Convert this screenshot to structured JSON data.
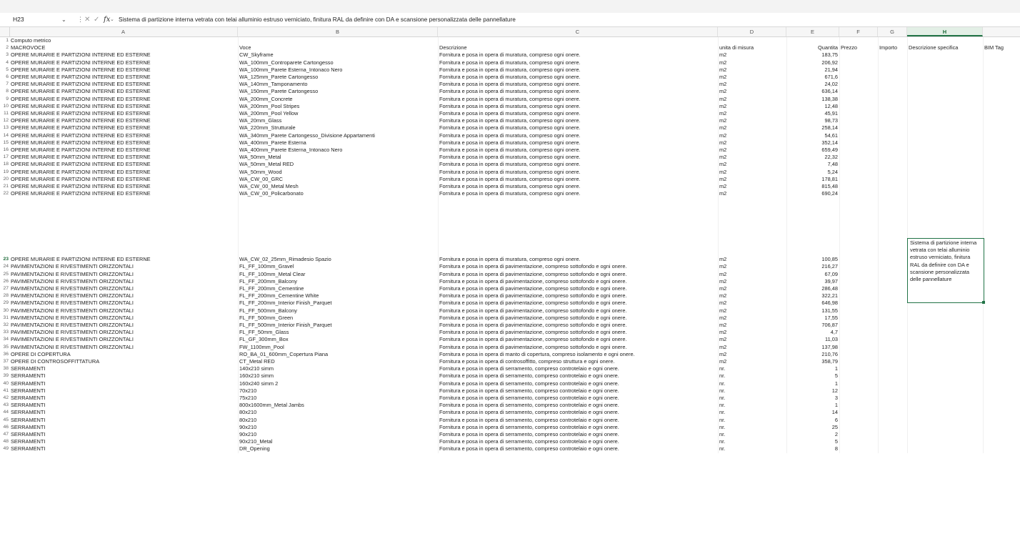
{
  "formula_bar": {
    "name_box": "H23",
    "formula": "Sistema di partizione interna vetrata con telai alluminio estruso verniciato, finitura RAL da definire con DA e scansione personalizzata delle pannellature"
  },
  "columns": [
    "A",
    "B",
    "C",
    "D",
    "E",
    "F",
    "G",
    "H"
  ],
  "selected_column": "H",
  "selected_row": "23",
  "rows": [
    {
      "n": "1",
      "a": "Computo metrico",
      "b": "",
      "c": "",
      "d": "",
      "e": "",
      "f": "",
      "g": "",
      "h": "",
      "i": ""
    },
    {
      "n": "2",
      "a": "MACROVOCE",
      "b": "Voce",
      "c": "Descrizione",
      "d": "unita di misura",
      "e": "Quantita",
      "f": "Prezzo",
      "g": "Importo",
      "h": "Descrizione specifica",
      "i": "BIM Tag"
    },
    {
      "n": "3",
      "a": "OPERE MURARIE E PARTIZIONI INTERNE ED ESTERNE",
      "b": "CW_Skyframe",
      "c": "Fornitura e posa in opera di muratura, compreso ogni onere.",
      "d": "m2",
      "e": "183,75"
    },
    {
      "n": "4",
      "a": "OPERE MURARIE E PARTIZIONI INTERNE ED ESTERNE",
      "b": "WA_100mm_Controparete Cartongesso",
      "c": "Fornitura e posa in opera di muratura, compreso ogni onere.",
      "d": "m2",
      "e": "206,92"
    },
    {
      "n": "5",
      "a": "OPERE MURARIE E PARTIZIONI INTERNE ED ESTERNE",
      "b": "WA_100mm_Parete Esterna_Intonaco Nero",
      "c": "Fornitura e posa in opera di muratura, compreso ogni onere.",
      "d": "m2",
      "e": "21,94"
    },
    {
      "n": "6",
      "a": "OPERE MURARIE E PARTIZIONI INTERNE ED ESTERNE",
      "b": "WA_125mm_Parete Cartongesso",
      "c": "Fornitura e posa in opera di muratura, compreso ogni onere.",
      "d": "m2",
      "e": "671,6"
    },
    {
      "n": "7",
      "a": "OPERE MURARIE E PARTIZIONI INTERNE ED ESTERNE",
      "b": "WA_140mm_Tamponamento",
      "c": "Fornitura e posa in opera di muratura, compreso ogni onere.",
      "d": "m2",
      "e": "24,02"
    },
    {
      "n": "8",
      "a": "OPERE MURARIE E PARTIZIONI INTERNE ED ESTERNE",
      "b": "WA_150mm_Parete Cartongesso",
      "c": "Fornitura e posa in opera di muratura, compreso ogni onere.",
      "d": "m2",
      "e": "636,14"
    },
    {
      "n": "9",
      "a": "OPERE MURARIE E PARTIZIONI INTERNE ED ESTERNE",
      "b": "WA_200mm_Concrete",
      "c": "Fornitura e posa in opera di muratura, compreso ogni onere.",
      "d": "m2",
      "e": "138,38"
    },
    {
      "n": "10",
      "a": "OPERE MURARIE E PARTIZIONI INTERNE ED ESTERNE",
      "b": "WA_200mm_Pool Stripes",
      "c": "Fornitura e posa in opera di muratura, compreso ogni onere.",
      "d": "m2",
      "e": "12,48"
    },
    {
      "n": "11",
      "a": "OPERE MURARIE E PARTIZIONI INTERNE ED ESTERNE",
      "b": "WA_200mm_Pool Yellow",
      "c": "Fornitura e posa in opera di muratura, compreso ogni onere.",
      "d": "m2",
      "e": "45,91"
    },
    {
      "n": "12",
      "a": "OPERE MURARIE E PARTIZIONI INTERNE ED ESTERNE",
      "b": "WA_20mm_Glass",
      "c": "Fornitura e posa in opera di muratura, compreso ogni onere.",
      "d": "m2",
      "e": "98,73"
    },
    {
      "n": "13",
      "a": "OPERE MURARIE E PARTIZIONI INTERNE ED ESTERNE",
      "b": "WA_220mm_Strutturale",
      "c": "Fornitura e posa in opera di muratura, compreso ogni onere.",
      "d": "m2",
      "e": "258,14"
    },
    {
      "n": "14",
      "a": "OPERE MURARIE E PARTIZIONI INTERNE ED ESTERNE",
      "b": "WA_340mm_Parete Cartongesso_Divisione Appartamenti",
      "c": "Fornitura e posa in opera di muratura, compreso ogni onere.",
      "d": "m2",
      "e": "54,61"
    },
    {
      "n": "15",
      "a": "OPERE MURARIE E PARTIZIONI INTERNE ED ESTERNE",
      "b": "WA_400mm_Parete Esterna",
      "c": "Fornitura e posa in opera di muratura, compreso ogni onere.",
      "d": "m2",
      "e": "352,14"
    },
    {
      "n": "16",
      "a": "OPERE MURARIE E PARTIZIONI INTERNE ED ESTERNE",
      "b": "WA_400mm_Parete Esterna_Intonaco Nero",
      "c": "Fornitura e posa in opera di muratura, compreso ogni onere.",
      "d": "m2",
      "e": "659,49"
    },
    {
      "n": "17",
      "a": "OPERE MURARIE E PARTIZIONI INTERNE ED ESTERNE",
      "b": "WA_50mm_Metal",
      "c": "Fornitura e posa in opera di muratura, compreso ogni onere.",
      "d": "m2",
      "e": "22,32"
    },
    {
      "n": "18",
      "a": "OPERE MURARIE E PARTIZIONI INTERNE ED ESTERNE",
      "b": "WA_50mm_Metal RED",
      "c": "Fornitura e posa in opera di muratura, compreso ogni onere.",
      "d": "m2",
      "e": "7,48"
    },
    {
      "n": "19",
      "a": "OPERE MURARIE E PARTIZIONI INTERNE ED ESTERNE",
      "b": "WA_50mm_Wood",
      "c": "Fornitura e posa in opera di muratura, compreso ogni onere.",
      "d": "m2",
      "e": "5,24"
    },
    {
      "n": "20",
      "a": "OPERE MURARIE E PARTIZIONI INTERNE ED ESTERNE",
      "b": "WA_CW_00_GRC",
      "c": "Fornitura e posa in opera di muratura, compreso ogni onere.",
      "d": "m2",
      "e": "178,81"
    },
    {
      "n": "21",
      "a": "OPERE MURARIE E PARTIZIONI INTERNE ED ESTERNE",
      "b": "WA_CW_00_Metal Mesh",
      "c": "Fornitura e posa in opera di muratura, compreso ogni onere.",
      "d": "m2",
      "e": "815,48"
    },
    {
      "n": "22",
      "a": "OPERE MURARIE E PARTIZIONI INTERNE ED ESTERNE",
      "b": "WA_CW_00_Policarbonato",
      "c": "Fornitura e posa in opera di muratura, compreso ogni onere.",
      "d": "m2",
      "e": "690,24"
    },
    {
      "n": "23",
      "a": "OPERE MURARIE E PARTIZIONI INTERNE ED ESTERNE",
      "b": "WA_CW_02_25mm_Rimadesio Spazio",
      "c": "Fornitura e posa in opera di muratura, compreso ogni onere.",
      "d": "m2",
      "e": "100,85",
      "h": "Sistema di partizione interna vetrata con telai alluminio estruso verniciato, finitura RAL da definire con DA e scansione personalizzata delle pannellature"
    },
    {
      "n": "24",
      "a": "PAVIMENTAZIONI E RIVESTIMENTI ORIZZONTALI",
      "b": "FL_FF_100mm_Gravel",
      "c": "Fornitura e posa in opera di pavimentazione, compreso sottofondo e ogni onere.",
      "d": "m2",
      "e": "216,27"
    },
    {
      "n": "25",
      "a": "PAVIMENTAZIONI E RIVESTIMENTI ORIZZONTALI",
      "b": "FL_FF_100mm_Metal Clear",
      "c": "Fornitura e posa in opera di pavimentazione, compreso sottofondo e ogni onere.",
      "d": "m2",
      "e": "67,09"
    },
    {
      "n": "26",
      "a": "PAVIMENTAZIONI E RIVESTIMENTI ORIZZONTALI",
      "b": "FL_FF_200mm_Balcony",
      "c": "Fornitura e posa in opera di pavimentazione, compreso sottofondo e ogni onere.",
      "d": "m2",
      "e": "39,97"
    },
    {
      "n": "27",
      "a": "PAVIMENTAZIONI E RIVESTIMENTI ORIZZONTALI",
      "b": "FL_FF_200mm_Cementine",
      "c": "Fornitura e posa in opera di pavimentazione, compreso sottofondo e ogni onere.",
      "d": "m2",
      "e": "286,48"
    },
    {
      "n": "28",
      "a": "PAVIMENTAZIONI E RIVESTIMENTI ORIZZONTALI",
      "b": "FL_FF_200mm_Cementine White",
      "c": "Fornitura e posa in opera di pavimentazione, compreso sottofondo e ogni onere.",
      "d": "m2",
      "e": "322,21"
    },
    {
      "n": "29",
      "a": "PAVIMENTAZIONI E RIVESTIMENTI ORIZZONTALI",
      "b": "FL_FF_200mm_Interior Finish_Parquet",
      "c": "Fornitura e posa in opera di pavimentazione, compreso sottofondo e ogni onere.",
      "d": "m2",
      "e": "646,98"
    },
    {
      "n": "30",
      "a": "PAVIMENTAZIONI E RIVESTIMENTI ORIZZONTALI",
      "b": "FL_FF_500mm_Balcony",
      "c": "Fornitura e posa in opera di pavimentazione, compreso sottofondo e ogni onere.",
      "d": "m2",
      "e": "131,55"
    },
    {
      "n": "31",
      "a": "PAVIMENTAZIONI E RIVESTIMENTI ORIZZONTALI",
      "b": "FL_FF_500mm_Green",
      "c": "Fornitura e posa in opera di pavimentazione, compreso sottofondo e ogni onere.",
      "d": "m2",
      "e": "17,55"
    },
    {
      "n": "32",
      "a": "PAVIMENTAZIONI E RIVESTIMENTI ORIZZONTALI",
      "b": "FL_FF_500mm_Interior Finish_Parquet",
      "c": "Fornitura e posa in opera di pavimentazione, compreso sottofondo e ogni onere.",
      "d": "m2",
      "e": "706,87"
    },
    {
      "n": "33",
      "a": "PAVIMENTAZIONI E RIVESTIMENTI ORIZZONTALI",
      "b": "FL_FF_50mm_Glass",
      "c": "Fornitura e posa in opera di pavimentazione, compreso sottofondo e ogni onere.",
      "d": "m2",
      "e": "4,7"
    },
    {
      "n": "34",
      "a": "PAVIMENTAZIONI E RIVESTIMENTI ORIZZONTALI",
      "b": "FL_GF_300mm_Box",
      "c": "Fornitura e posa in opera di pavimentazione, compreso sottofondo e ogni onere.",
      "d": "m2",
      "e": "11,03"
    },
    {
      "n": "35",
      "a": "PAVIMENTAZIONI E RIVESTIMENTI ORIZZONTALI",
      "b": "FW_1100mm_Pool",
      "c": "Fornitura e posa in opera di pavimentazione, compreso sottofondo e ogni onere.",
      "d": "m2",
      "e": "137,98"
    },
    {
      "n": "36",
      "a": "OPERE DI COPERTURA",
      "b": "RO_BA_01_600mm_Copertura Piana",
      "c": "Fornitura e posa in opera di manto di copertura, compreso isolamento e ogni onere.",
      "d": "m2",
      "e": "210,76"
    },
    {
      "n": "37",
      "a": "OPERE DI CONTROSOFFITTATURA",
      "b": "CT_Metal RED",
      "c": "Fornitura e posa in opera di controsoffitto, compreso struttura e ogni onere.",
      "d": "m2",
      "e": "358,79"
    },
    {
      "n": "38",
      "a": "SERRAMENTI",
      "b": "140x210 simm",
      "c": "Fornitura e posa in opera di serramento, compreso controtelaio e ogni onere.",
      "d": "nr.",
      "e": "1"
    },
    {
      "n": "39",
      "a": "SERRAMENTI",
      "b": "160x210 simm",
      "c": "Fornitura e posa in opera di serramento, compreso controtelaio e ogni onere.",
      "d": "nr.",
      "e": "5"
    },
    {
      "n": "40",
      "a": "SERRAMENTI",
      "b": "160x240 simm 2",
      "c": "Fornitura e posa in opera di serramento, compreso controtelaio e ogni onere.",
      "d": "nr.",
      "e": "1"
    },
    {
      "n": "41",
      "a": "SERRAMENTI",
      "b": "70x210",
      "c": "Fornitura e posa in opera di serramento, compreso controtelaio e ogni onere.",
      "d": "nr.",
      "e": "12"
    },
    {
      "n": "42",
      "a": "SERRAMENTI",
      "b": "75x210",
      "c": "Fornitura e posa in opera di serramento, compreso controtelaio e ogni onere.",
      "d": "nr.",
      "e": "3"
    },
    {
      "n": "43",
      "a": "SERRAMENTI",
      "b": "800x1600mm_Metal Jambs",
      "c": "Fornitura e posa in opera di serramento, compreso controtelaio e ogni onere.",
      "d": "nr.",
      "e": "1"
    },
    {
      "n": "44",
      "a": "SERRAMENTI",
      "b": "80x210",
      "c": "Fornitura e posa in opera di serramento, compreso controtelaio e ogni onere.",
      "d": "nr.",
      "e": "14"
    },
    {
      "n": "45",
      "a": "SERRAMENTI",
      "b": "80x210",
      "c": "Fornitura e posa in opera di serramento, compreso controtelaio e ogni onere.",
      "d": "nr.",
      "e": "6"
    },
    {
      "n": "46",
      "a": "SERRAMENTI",
      "b": "90x210",
      "c": "Fornitura e posa in opera di serramento, compreso controtelaio e ogni onere.",
      "d": "nr.",
      "e": "25"
    },
    {
      "n": "47",
      "a": "SERRAMENTI",
      "b": "90x210",
      "c": "Fornitura e posa in opera di serramento, compreso controtelaio e ogni onere.",
      "d": "nr.",
      "e": "2"
    },
    {
      "n": "48",
      "a": "SERRAMENTI",
      "b": "90x210_Metal",
      "c": "Fornitura e posa in opera di serramento, compreso controtelaio e ogni onere.",
      "d": "nr.",
      "e": "5"
    },
    {
      "n": "49",
      "a": "SERRAMENTI",
      "b": "DR_Opening",
      "c": "Fornitura e posa in opera di serramento, compreso controtelaio e ogni onere.",
      "d": "nr.",
      "e": "8"
    }
  ]
}
